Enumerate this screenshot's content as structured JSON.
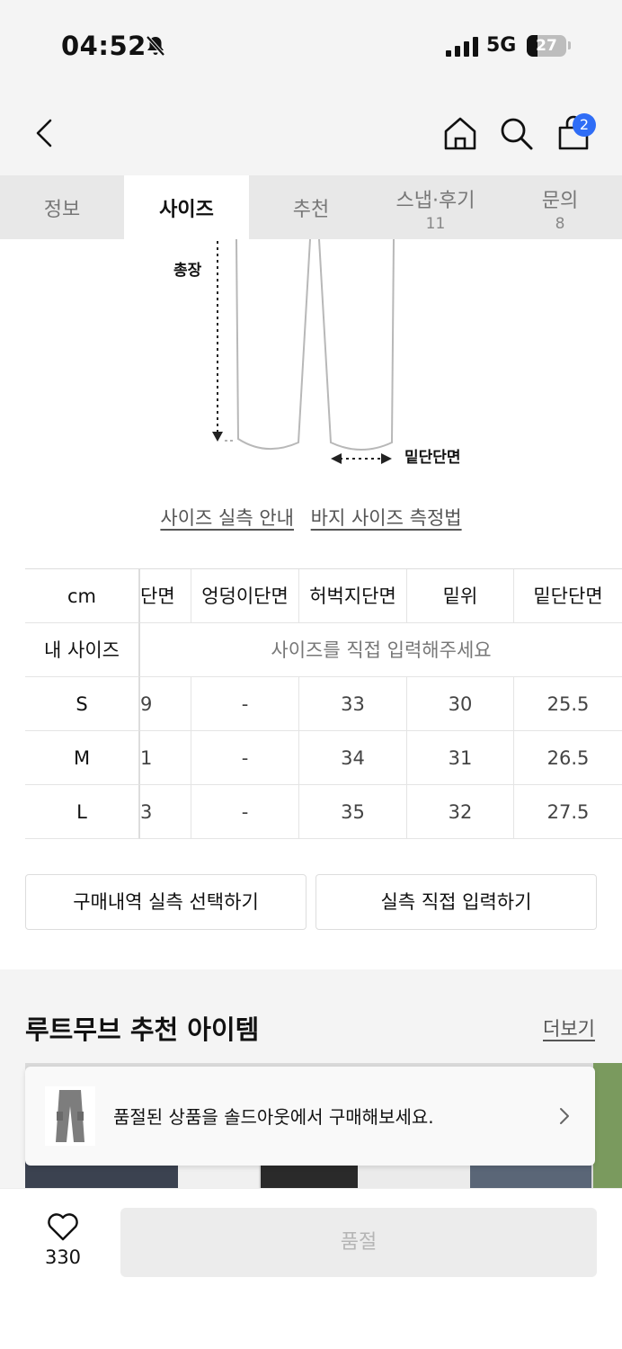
{
  "status_bar": {
    "time": "04:52",
    "network": "5G",
    "battery": "27"
  },
  "header": {
    "cart_count": "2"
  },
  "tabs": [
    {
      "label": "정보",
      "count": ""
    },
    {
      "label": "사이즈",
      "count": ""
    },
    {
      "label": "추천",
      "count": ""
    },
    {
      "label": "스냅·후기",
      "count": "11"
    },
    {
      "label": "문의",
      "count": "8"
    }
  ],
  "diagram": {
    "total_length_label": "총장",
    "hem_label": "밑단단면"
  },
  "links": {
    "size_guide": "사이즈 실측 안내",
    "measure_guide": "바지 사이즈 측정법"
  },
  "size_table": {
    "unit": "cm",
    "columns": [
      "단면",
      "엉덩이단면",
      "허벅지단면",
      "밑위",
      "밑단단면"
    ],
    "my_size_label": "내 사이즈",
    "my_size_placeholder": "사이즈를 직접 입력해주세요",
    "rows": [
      {
        "size": "S",
        "values": [
          "9",
          "-",
          "33",
          "30",
          "25.5"
        ]
      },
      {
        "size": "M",
        "values": [
          "1",
          "-",
          "34",
          "31",
          "26.5"
        ]
      },
      {
        "size": "L",
        "values": [
          "3",
          "-",
          "35",
          "32",
          "27.5"
        ]
      }
    ]
  },
  "actions": {
    "purchase_history": "구매내역 실측 선택하기",
    "manual_input": "실측 직접 입력하기"
  },
  "recommend": {
    "title": "루트무브 추천 아이템",
    "more": "더보기",
    "toast": "품절된 상품을 솔드아웃에서 구매해보세요."
  },
  "bottom": {
    "like_count": "330",
    "soldout": "품절"
  }
}
